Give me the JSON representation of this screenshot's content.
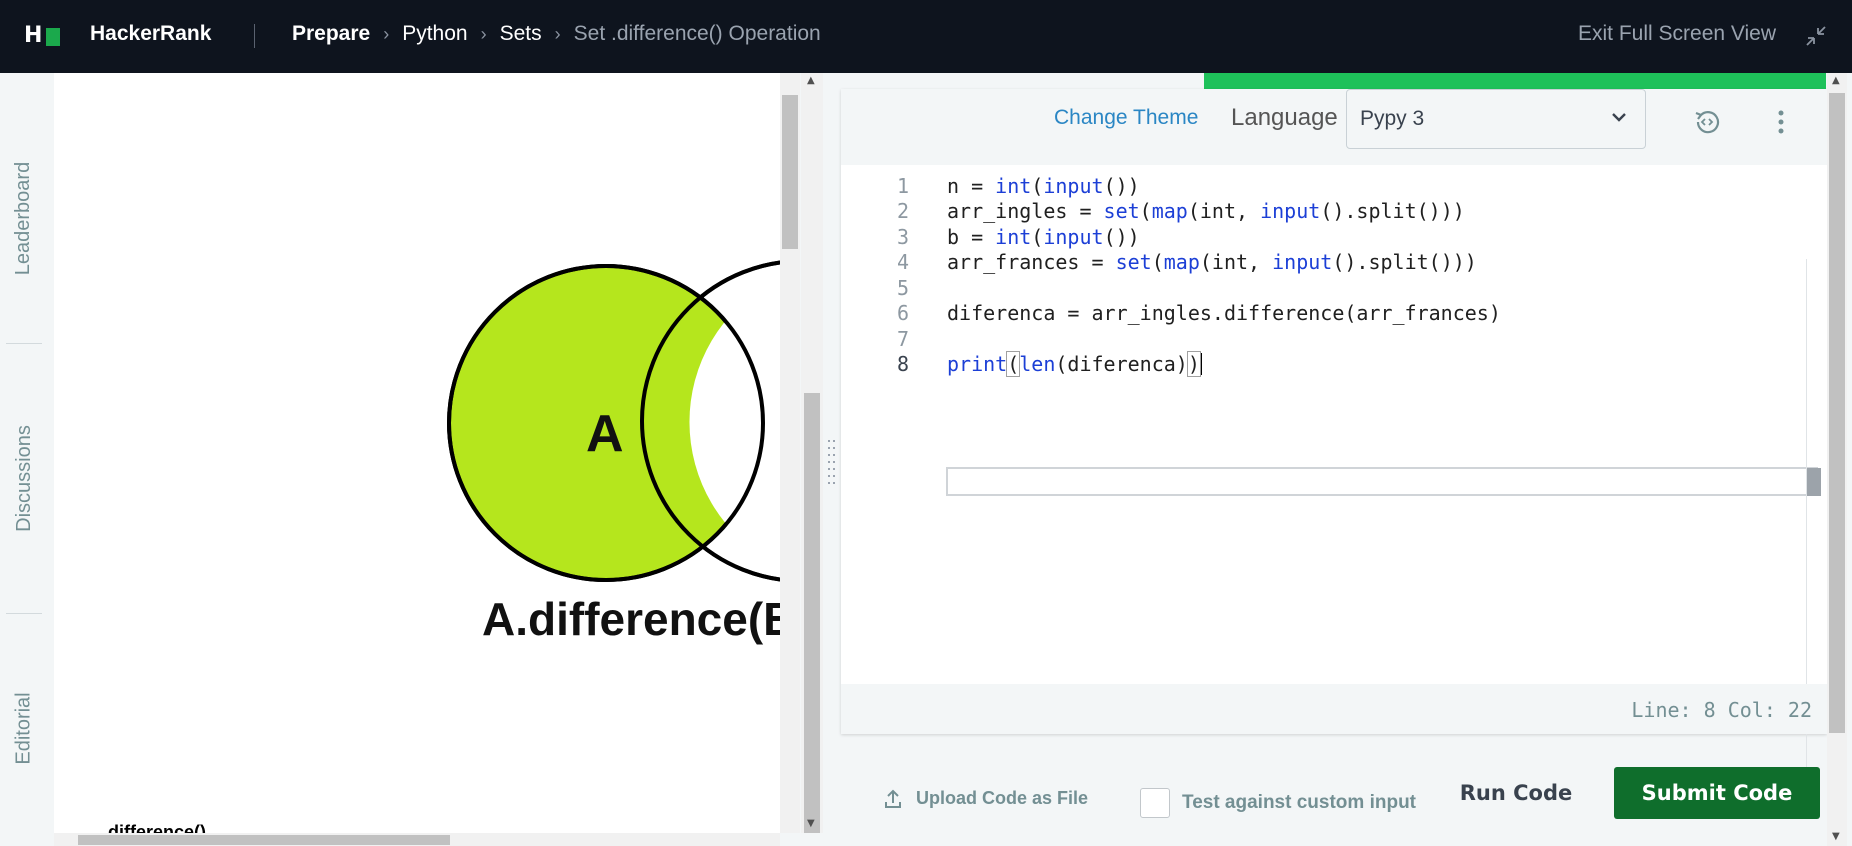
{
  "header": {
    "brand": "HackerRank",
    "breadcrumbs": [
      "Prepare",
      "Python",
      "Sets",
      "Set .difference() Operation"
    ],
    "exit_fullscreen": "Exit Full Screen View"
  },
  "sidenav": {
    "items": [
      "Leaderboard",
      "Discussions",
      "Editorial"
    ]
  },
  "problem": {
    "venn_label": "A",
    "venn_caption": "A.difference(B",
    "cut_text": "difference()"
  },
  "editor": {
    "change_theme": "Change Theme",
    "language_label": "Language",
    "language_value": "Pypy 3",
    "line_numbers": [
      "1",
      "2",
      "3",
      "4",
      "5",
      "6",
      "7",
      "8"
    ],
    "code_lines": [
      "n = int(input())",
      "arr_ingles = set(map(int, input().split()))",
      "b = int(input())",
      "arr_frances = set(map(int, input().split()))",
      "",
      "diferenca = arr_ingles.difference(arr_frances)",
      "",
      "print(len(diferenca))"
    ],
    "status": "Line: 8 Col: 22"
  },
  "actions": {
    "upload": "Upload Code as File",
    "custom_input": "Test against custom input",
    "run": "Run Code",
    "submit": "Submit Code"
  },
  "colors": {
    "topbar": "#0e141e",
    "brand_green": "#1ba94c",
    "submit_green": "#0f6e2c",
    "venn_fill": "#b5e61d",
    "link_blue": "#2a86c4",
    "keyword_blue": "#1c3fd6"
  }
}
